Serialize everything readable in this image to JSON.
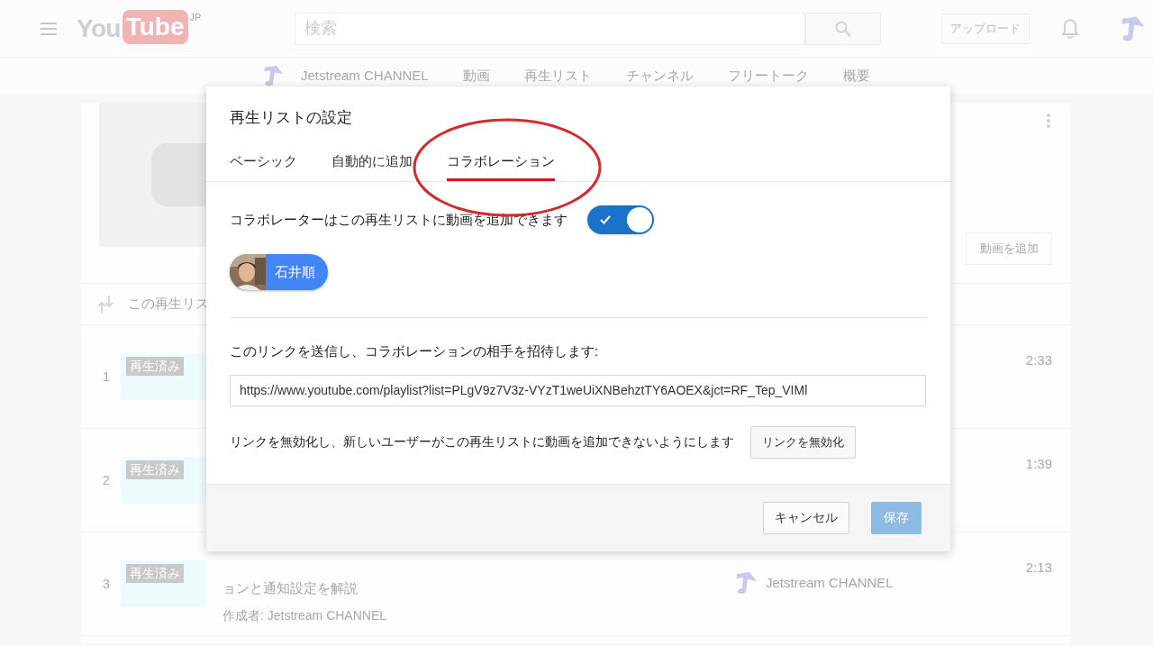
{
  "header": {
    "logo": {
      "part_1": "You",
      "part_2": "Tube",
      "region": "JP"
    },
    "search": {
      "placeholder": "検索"
    },
    "upload_button": "アップロード"
  },
  "channel_nav": {
    "channel_name": "Jetstream CHANNEL",
    "links": [
      "動画",
      "再生リスト",
      "チャンネル",
      "フリートーク",
      "概要"
    ]
  },
  "playlist": {
    "add_video_button": "動画を追加",
    "sort_label": "この再生リス",
    "videos": [
      {
        "index": "1",
        "badge": "再生済み",
        "duration": "2:33"
      },
      {
        "index": "2",
        "badge": "再生済み",
        "duration": "1:39"
      },
      {
        "index": "3",
        "badge": "再生済み",
        "duration": "2:13",
        "title": "ョンと通知設定を解説",
        "creator": "作成者: Jetstream CHANNEL",
        "channel": "Jetstream CHANNEL"
      }
    ]
  },
  "dialog": {
    "title": "再生リストの設定",
    "tabs": [
      {
        "label": "ベーシック",
        "selected": false
      },
      {
        "label": "自動的に追加",
        "selected": false
      },
      {
        "label": "コラボレーション",
        "selected": true
      }
    ],
    "collaborate": {
      "label": "コラボレーターはこの再生リストに動画を追加できます",
      "on": true
    },
    "collaborators": [
      {
        "name": "石井順"
      }
    ],
    "invite_label": "このリンクを送信し、コラボレーションの相手を招待します:",
    "invite_link": "https://www.youtube.com/playlist?list=PLgV9z7V3z-VYzT1weUiXNBehztTY6AOEX&jct=RF_Tep_VIMl",
    "disable": {
      "text": "リンクを無効化し、新しいユーザーがこの再生リストに動画を追加できないようにします",
      "button": "リンクを無効化"
    },
    "buttons": {
      "cancel": "キャンセル",
      "save": {
        "label": "保存",
        "disabled": true
      }
    }
  }
}
